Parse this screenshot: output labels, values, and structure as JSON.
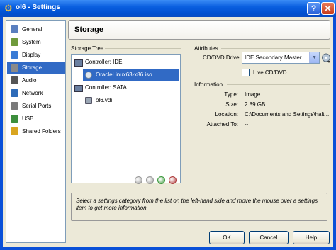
{
  "window": {
    "title": "ol6 - Settings",
    "help_glyph": "?",
    "close_glyph": "✕"
  },
  "sidebar": {
    "items": [
      {
        "label": "General",
        "icon": "general-icon",
        "color": "#5a7fbf"
      },
      {
        "label": "System",
        "icon": "system-icon",
        "color": "#6f9a3c"
      },
      {
        "label": "Display",
        "icon": "display-icon",
        "color": "#3a7bd5"
      },
      {
        "label": "Storage",
        "icon": "storage-icon",
        "color": "#8a8a8a",
        "selected": true
      },
      {
        "label": "Audio",
        "icon": "audio-icon",
        "color": "#555555"
      },
      {
        "label": "Network",
        "icon": "network-icon",
        "color": "#2e6bb8"
      },
      {
        "label": "Serial Ports",
        "icon": "serial-port-icon",
        "color": "#7a7a7a"
      },
      {
        "label": "USB",
        "icon": "usb-icon",
        "color": "#3d8f3d"
      },
      {
        "label": "Shared Folders",
        "icon": "shared-folder-icon",
        "color": "#d9a520"
      }
    ]
  },
  "page": {
    "title": "Storage",
    "storage_tree_label": "Storage Tree",
    "attributes_label": "Attributes",
    "information_label": "Information"
  },
  "tree": {
    "controllers": [
      {
        "name": "Controller: IDE",
        "icon": "ide-controller-icon",
        "devices": [
          {
            "name": "OracleLinux63-x86.iso",
            "icon": "cd-icon",
            "selected": true
          }
        ]
      },
      {
        "name": "Controller: SATA",
        "icon": "sata-controller-icon",
        "devices": [
          {
            "name": "ol6.vdi",
            "icon": "hard-disk-icon"
          }
        ]
      }
    ],
    "buttons": [
      {
        "name": "add-controller-button",
        "icon": "add-controller-icon",
        "color": "#9a9a9a"
      },
      {
        "name": "remove-controller-button",
        "icon": "remove-controller-icon",
        "color": "#9a9a9a"
      },
      {
        "name": "add-attachment-button",
        "icon": "add-attachment-icon",
        "color": "#3e9a3e"
      },
      {
        "name": "remove-attachment-button",
        "icon": "remove-attachment-icon",
        "color": "#b04040"
      }
    ]
  },
  "attributes": {
    "drive_label": "CD/DVD Drive:",
    "drive_value": "IDE Secondary Master",
    "live_cd_label": "Live CD/DVD",
    "live_cd_checked": false
  },
  "information": {
    "rows": [
      {
        "key": "Type:",
        "value": "Image"
      },
      {
        "key": "Size:",
        "value": "2.89 GB"
      },
      {
        "key": "Location:",
        "value": "C:\\Documents and Settings\\halt..."
      },
      {
        "key": "Attached To:",
        "value": "--"
      }
    ]
  },
  "help_text": "Select a settings category from the list on the left-hand side and move the mouse over a settings item to get more information.",
  "buttons": {
    "ok": "OK",
    "cancel": "Cancel",
    "help": "Help"
  }
}
